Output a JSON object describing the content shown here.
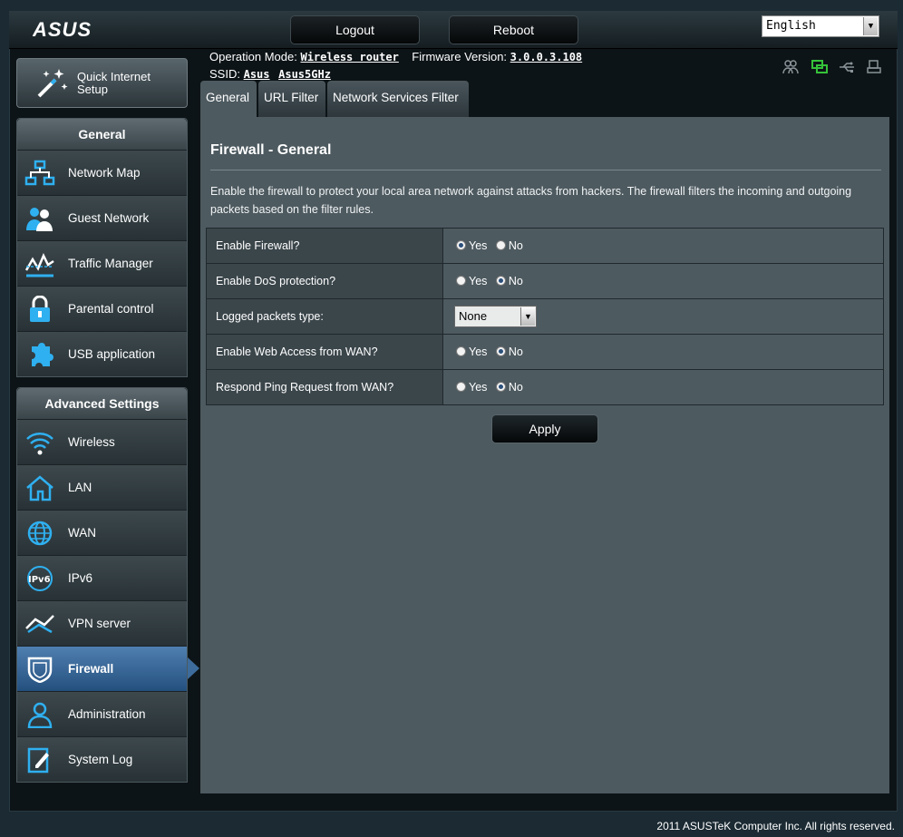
{
  "header": {
    "logo": "ASUS",
    "logout_label": "Logout",
    "reboot_label": "Reboot",
    "language": "English",
    "operation_mode_label": "Operation Mode:",
    "operation_mode_value": "Wireless router",
    "firmware_label": "Firmware Version:",
    "firmware_value": "3.0.0.3.108",
    "ssid_label": "SSID:",
    "ssid_values": [
      "Asus",
      "Asus5GHz"
    ],
    "status_icons": [
      "clients-icon",
      "network-status-icon",
      "usb-icon",
      "printer-icon"
    ]
  },
  "sidebar": {
    "quick_setup_label": "Quick Internet Setup",
    "general": {
      "title": "General",
      "items": [
        {
          "label": "Network Map",
          "icon": "network-map-icon"
        },
        {
          "label": "Guest Network",
          "icon": "guest-network-icon"
        },
        {
          "label": "Traffic Manager",
          "icon": "traffic-manager-icon"
        },
        {
          "label": "Parental control",
          "icon": "parental-control-icon"
        },
        {
          "label": "USB application",
          "icon": "usb-application-icon"
        }
      ]
    },
    "advanced": {
      "title": "Advanced Settings",
      "items": [
        {
          "label": "Wireless",
          "icon": "wireless-icon"
        },
        {
          "label": "LAN",
          "icon": "lan-icon"
        },
        {
          "label": "WAN",
          "icon": "wan-icon"
        },
        {
          "label": "IPv6",
          "icon": "ipv6-icon"
        },
        {
          "label": "VPN server",
          "icon": "vpn-icon"
        },
        {
          "label": "Firewall",
          "icon": "firewall-icon",
          "active": true
        },
        {
          "label": "Administration",
          "icon": "administration-icon"
        },
        {
          "label": "System Log",
          "icon": "system-log-icon"
        }
      ]
    }
  },
  "tabs": [
    {
      "label": "General",
      "active": true
    },
    {
      "label": "URL Filter"
    },
    {
      "label": "Network Services Filter"
    }
  ],
  "main": {
    "title": "Firewall - General",
    "description": "Enable the firewall to protect your local area network against attacks from hackers. The firewall filters the incoming and outgoing packets based on the filter rules.",
    "yes_label": "Yes",
    "no_label": "No",
    "rows": [
      {
        "label": "Enable Firewall?",
        "value": "Yes"
      },
      {
        "label": "Enable DoS protection?",
        "value": "No"
      },
      {
        "label": "Logged packets type:",
        "value": "None"
      },
      {
        "label": "Enable Web Access from WAN?",
        "value": "No"
      },
      {
        "label": "Respond Ping Request from WAN?",
        "value": "No"
      }
    ],
    "apply_label": "Apply"
  },
  "footer": {
    "copyright": "2011 ASUSTeK Computer Inc. All rights reserved."
  },
  "colors": {
    "accent_active": "#2f6aa0",
    "content_bg": "#4d5a60",
    "icon_blue": "#2fb0f0",
    "status_green": "#35c23a"
  }
}
